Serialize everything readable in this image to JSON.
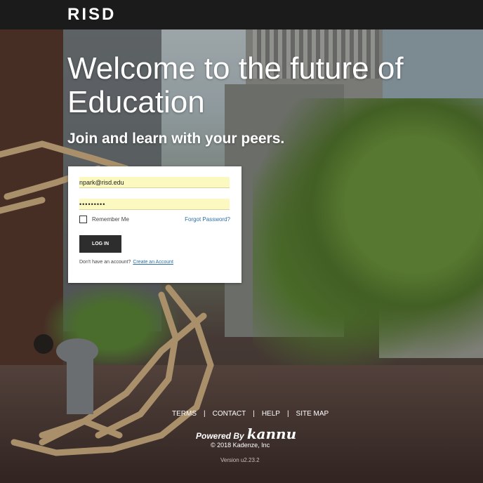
{
  "header": {
    "logo": "RISD"
  },
  "hero": {
    "headline": "Welcome to the future of Education",
    "subheadline": "Join and learn with your peers."
  },
  "login": {
    "email_value": "npark@risd.edu",
    "password_value": "•••••••••",
    "remember_label": "Remember Me",
    "forgot_label": "Forgot Password?",
    "login_label": "LOG IN",
    "signup_prompt": "Don't have an account?",
    "signup_link": "Create an Account"
  },
  "footer": {
    "links": [
      "TERMS",
      "CONTACT",
      "HELP",
      "SITE MAP"
    ],
    "powered_by": "Powered By",
    "brand": "kannu",
    "copyright": "© 2018 Kadenze, Inc",
    "version": "Version u2.23.2"
  }
}
